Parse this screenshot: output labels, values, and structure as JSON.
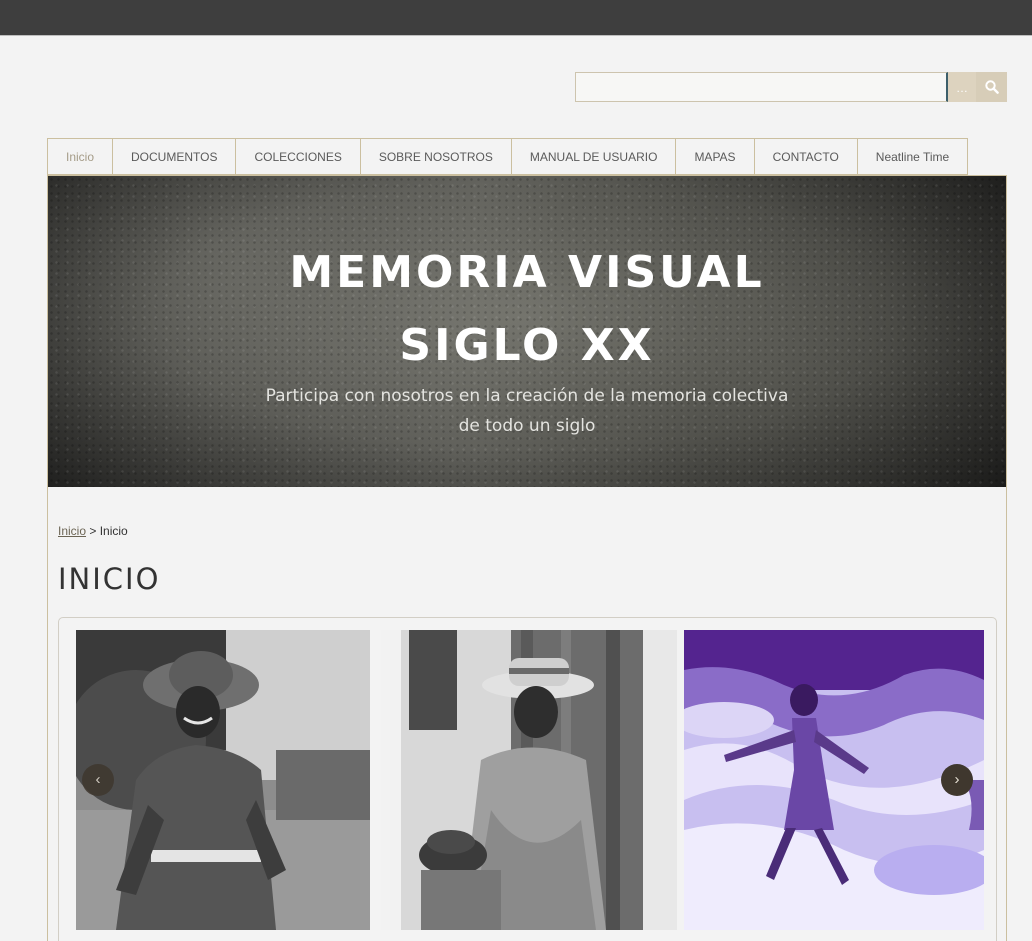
{
  "search": {
    "value": "",
    "placeholder": "",
    "advanced_label": "…"
  },
  "nav": {
    "items": [
      {
        "label": "Inicio"
      },
      {
        "label": "DOCUMENTOS"
      },
      {
        "label": "COLECCIONES"
      },
      {
        "label": "SOBRE NOSOTROS"
      },
      {
        "label": "MANUAL DE USUARIO"
      },
      {
        "label": "MAPAS"
      },
      {
        "label": "CONTACTO"
      },
      {
        "label": "Neatline Time"
      }
    ]
  },
  "hero": {
    "title_line1": "MEMORIA VISUAL",
    "title_line2": "SIGLO XX",
    "subtitle_line1": "Participa con nosotros en la creación de la memoria colectiva",
    "subtitle_line2": "de todo un siglo"
  },
  "breadcrumb": {
    "link": "Inicio",
    "separator": " > ",
    "current": "Inicio"
  },
  "page_title": "INICIO",
  "carousel": {
    "prev_label": "‹",
    "next_label": "›"
  },
  "colors": {
    "accent": "#cbbf9f",
    "topbar": "#3e3e3e",
    "arrow": "#3f372e"
  }
}
